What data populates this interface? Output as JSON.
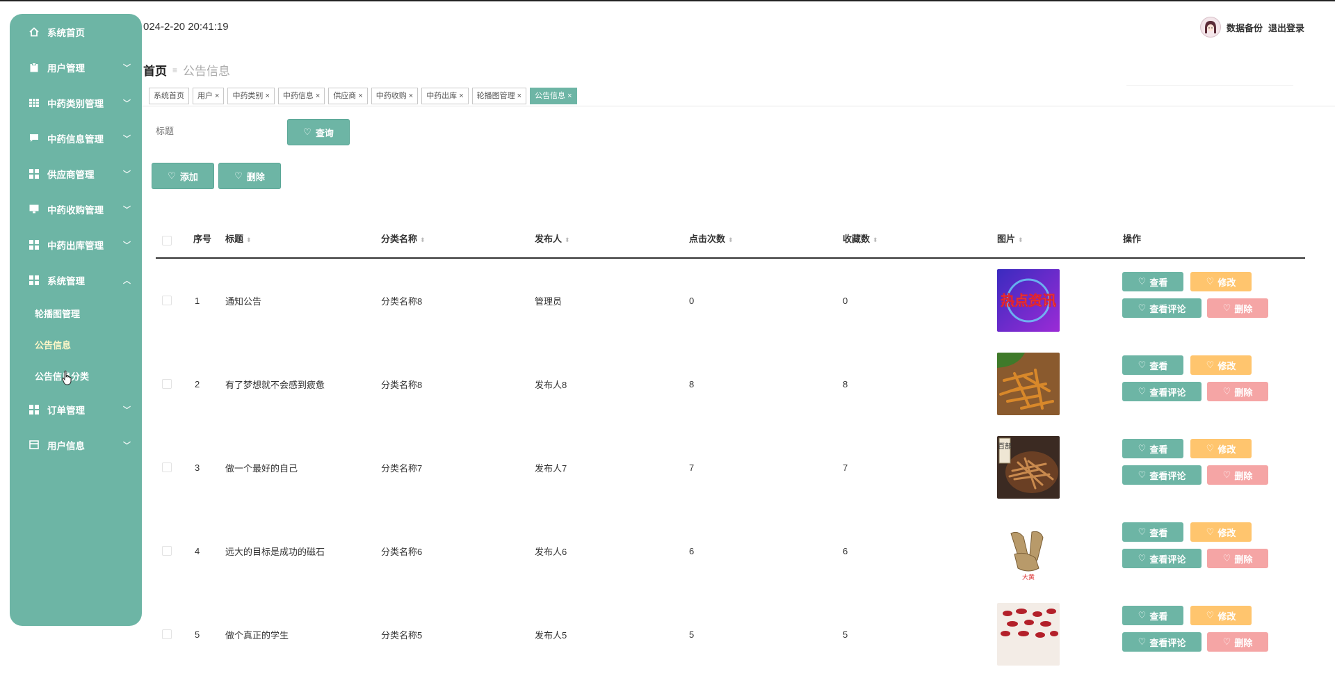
{
  "header": {
    "datetime": "024-2-20 20:41:19",
    "backup_label": "数据备份",
    "logout_label": "退出登录"
  },
  "sidebar": {
    "items": [
      {
        "label": "系统首页",
        "icon": "home-icon"
      },
      {
        "label": "用户管理",
        "icon": "clipboard-icon"
      },
      {
        "label": "中药类别管理",
        "icon": "grid-icon"
      },
      {
        "label": "中药信息管理",
        "icon": "chat-icon"
      },
      {
        "label": "供应商管理",
        "icon": "grid-icon"
      },
      {
        "label": "中药收购管理",
        "icon": "monitor-icon"
      },
      {
        "label": "中药出库管理",
        "icon": "grid-icon"
      },
      {
        "label": "系统管理",
        "icon": "grid-icon"
      },
      {
        "label": "订单管理",
        "icon": "grid-icon"
      },
      {
        "label": "用户信息",
        "icon": "card-icon"
      }
    ],
    "system_sub": [
      "轮播图管理",
      "公告信息",
      "公告信息分类"
    ]
  },
  "breadcrumb": {
    "home": "首页",
    "current": "公告信息"
  },
  "tabs": [
    "系统首页",
    "用户",
    "中药类别",
    "中药信息",
    "供应商",
    "中药收购",
    "中药出库",
    "轮播图管理",
    "公告信息"
  ],
  "search": {
    "placeholder": "标题",
    "button": "查询"
  },
  "actions": {
    "add": "添加",
    "delete": "删除"
  },
  "table": {
    "columns": [
      "序号",
      "标题",
      "分类名称",
      "发布人",
      "点击次数",
      "收藏数",
      "图片",
      "操作"
    ],
    "rows": [
      {
        "no": "1",
        "title": "通知公告",
        "category": "分类名称8",
        "publisher": "管理员",
        "clicks": "0",
        "favorites": "0"
      },
      {
        "no": "2",
        "title": "有了梦想就不会感到疲惫",
        "category": "分类名称8",
        "publisher": "发布人8",
        "clicks": "8",
        "favorites": "8"
      },
      {
        "no": "3",
        "title": "做一个最好的自己",
        "category": "分类名称7",
        "publisher": "发布人7",
        "clicks": "7",
        "favorites": "7"
      },
      {
        "no": "4",
        "title": "远大的目标是成功的磁石",
        "category": "分类名称6",
        "publisher": "发布人6",
        "clicks": "6",
        "favorites": "6"
      },
      {
        "no": "5",
        "title": "做个真正的学生",
        "category": "分类名称5",
        "publisher": "发布人5",
        "clicks": "5",
        "favorites": "5"
      }
    ],
    "ops": {
      "view": "查看",
      "edit": "修改",
      "comments": "查看评论",
      "delete": "删除"
    }
  },
  "images": {
    "news_banner_text": "热点资讯",
    "herb_box_text": "百部",
    "herb_caption": "大黄"
  },
  "colors": {
    "primary": "#6db5a5",
    "edit": "#ffc56e",
    "delete": "#f5a5a5"
  }
}
